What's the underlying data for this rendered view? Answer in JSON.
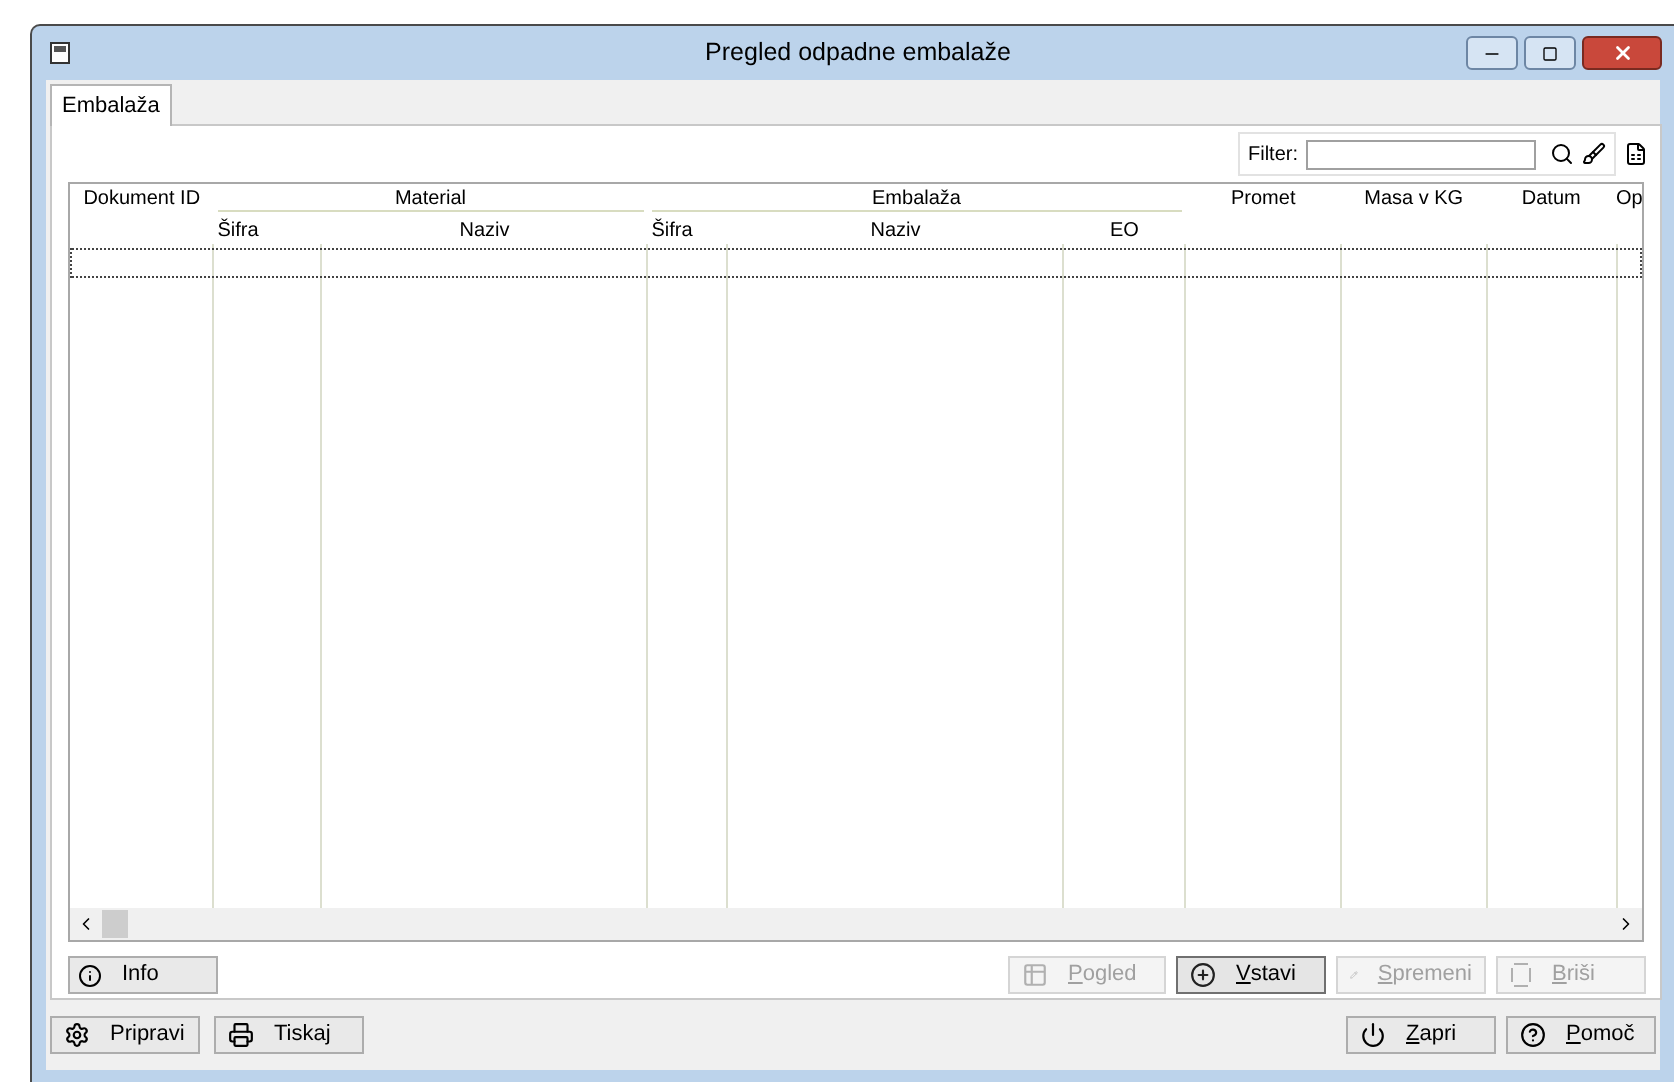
{
  "window": {
    "title": "Pregled odpadne embalaže"
  },
  "tabs": [
    {
      "label": "Embalaža",
      "selected": true
    }
  ],
  "filter": {
    "label": "Filter:"
  },
  "table": {
    "header": [
      {
        "kind": "single",
        "label": "Dokument ID"
      },
      {
        "kind": "group",
        "label": "Material",
        "columns": [
          {
            "label": "Šifra"
          },
          {
            "label": "Naziv"
          }
        ]
      },
      {
        "kind": "group",
        "label": "Embalaža",
        "columns": [
          {
            "label": "Šifra"
          },
          {
            "label": "Naziv"
          },
          {
            "label": "EO"
          }
        ]
      },
      {
        "kind": "single",
        "label": "Promet"
      },
      {
        "kind": "single",
        "label": "Masa v KG"
      },
      {
        "kind": "single",
        "label": "Datum"
      },
      {
        "kind": "single",
        "label": "Op"
      }
    ]
  },
  "info_button": {
    "label": "Info"
  },
  "actions": [
    {
      "label": "Pogled",
      "disabled": true,
      "focused": false
    },
    {
      "label": "Vstavi",
      "disabled": false,
      "focused": true
    },
    {
      "label": "Spremeni",
      "disabled": true,
      "focused": false
    },
    {
      "label": "Briši",
      "disabled": true,
      "focused": false
    }
  ],
  "footer_left": [
    {
      "label": "Pripravi"
    },
    {
      "label": "Tiskaj"
    }
  ],
  "footer_right": [
    {
      "label": "Zapri"
    },
    {
      "label": "Pomoč"
    }
  ]
}
